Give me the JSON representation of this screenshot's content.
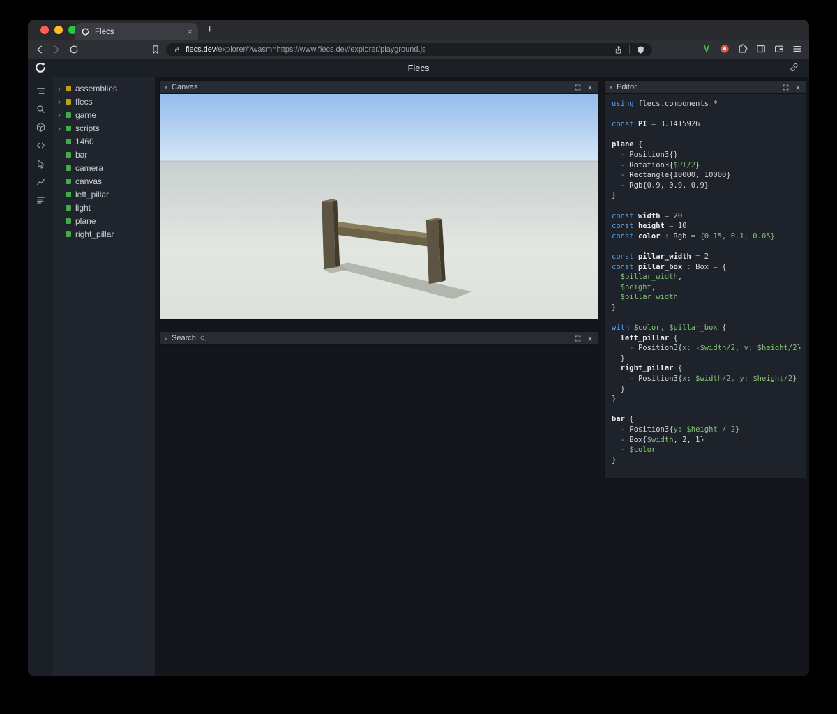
{
  "browser": {
    "tab": {
      "title": "Flecs"
    },
    "new_tab_label": "+",
    "url": {
      "domain": "flecs.dev",
      "path": "/explorer/?wasm=https://www.flecs.dev/explorer/playground.js"
    },
    "toolbar_icon_names": [
      "back-icon",
      "forward-icon",
      "reload-icon",
      "bookmark-icon",
      "lock-icon",
      "share-icon",
      "brave-shield-icon",
      "vimium-extension-icon",
      "red-extension-icon",
      "extensions-puzzle-icon",
      "sidebar-toggle-icon",
      "wallet-icon",
      "menu-icon"
    ]
  },
  "app": {
    "header": {
      "title": "Flecs"
    },
    "sidebar_tools": [
      {
        "name": "entity-tree",
        "icon": "tree"
      },
      {
        "name": "query-search",
        "icon": "search"
      },
      {
        "name": "entities-cube",
        "icon": "cube"
      },
      {
        "name": "script-code",
        "icon": "code"
      },
      {
        "name": "inspector",
        "icon": "inspect"
      },
      {
        "name": "charts",
        "icon": "chart"
      },
      {
        "name": "stats",
        "icon": "stats"
      }
    ],
    "tree": {
      "items": [
        {
          "label": "assemblies",
          "expandable": true,
          "color": "#bfa118"
        },
        {
          "label": "flecs",
          "expandable": true,
          "color": "#bfa118"
        },
        {
          "label": "game",
          "expandable": true,
          "color": "#3fae49"
        },
        {
          "label": "scripts",
          "expandable": true,
          "color": "#3fae49"
        },
        {
          "label": "1460",
          "expandable": false,
          "color": "#3fae49"
        },
        {
          "label": "bar",
          "expandable": false,
          "color": "#3fae49"
        },
        {
          "label": "camera",
          "expandable": false,
          "color": "#3fae49"
        },
        {
          "label": "canvas",
          "expandable": false,
          "color": "#3fae49"
        },
        {
          "label": "left_pillar",
          "expandable": false,
          "color": "#3fae49"
        },
        {
          "label": "light",
          "expandable": false,
          "color": "#3fae49"
        },
        {
          "label": "plane",
          "expandable": false,
          "color": "#3fae49"
        },
        {
          "label": "right_pillar",
          "expandable": false,
          "color": "#3fae49"
        }
      ]
    },
    "panels": {
      "canvas": {
        "title": "Canvas"
      },
      "search": {
        "title": "Search"
      },
      "editor": {
        "title": "Editor"
      }
    },
    "scene": {
      "objects": [
        "plane",
        "left_pillar",
        "right_pillar",
        "bar"
      ],
      "sky_top": "#93bdeb",
      "sky_bottom": "#d5e5f7",
      "ground": "#dfe3de",
      "pillar_color": "#5d5443",
      "bar_color": "#6b6147"
    },
    "editor_code": {
      "lines": [
        [
          [
            "k",
            "using "
          ],
          [
            "w",
            "flecs"
          ],
          [
            "p",
            "."
          ],
          [
            "w",
            "components"
          ],
          [
            "p",
            "."
          ],
          [
            "w",
            "*"
          ]
        ],
        [],
        [
          [
            "k",
            "const "
          ],
          [
            "b",
            "PI"
          ],
          [
            "p",
            " = "
          ],
          [
            "w",
            "3.1415926"
          ]
        ],
        [],
        [
          [
            "b",
            "plane"
          ],
          [
            "w",
            " {"
          ]
        ],
        [
          [
            "p",
            "  - "
          ],
          [
            "w",
            "Position3{}"
          ]
        ],
        [
          [
            "p",
            "  - "
          ],
          [
            "w",
            "Rotation3{"
          ],
          [
            "g",
            "$PI/2"
          ],
          [
            "w",
            "}"
          ]
        ],
        [
          [
            "p",
            "  - "
          ],
          [
            "w",
            "Rectangle{10000, 10000}"
          ]
        ],
        [
          [
            "p",
            "  - "
          ],
          [
            "w",
            "Rgb{0.9, 0.9, 0.9}"
          ]
        ],
        [
          [
            "w",
            "}"
          ]
        ],
        [],
        [
          [
            "k",
            "const "
          ],
          [
            "b",
            "width"
          ],
          [
            "p",
            " = "
          ],
          [
            "w",
            "20"
          ]
        ],
        [
          [
            "k",
            "const "
          ],
          [
            "b",
            "height"
          ],
          [
            "p",
            " = "
          ],
          [
            "w",
            "10"
          ]
        ],
        [
          [
            "k",
            "const "
          ],
          [
            "b",
            "color"
          ],
          [
            "p",
            " : "
          ],
          [
            "w",
            "Rgb"
          ],
          [
            "p",
            " = "
          ],
          [
            "g",
            "{0.15, 0.1, 0.05}"
          ]
        ],
        [],
        [
          [
            "k",
            "const "
          ],
          [
            "b",
            "pillar_width"
          ],
          [
            "p",
            " = "
          ],
          [
            "w",
            "2"
          ]
        ],
        [
          [
            "k",
            "const "
          ],
          [
            "b",
            "pillar_box"
          ],
          [
            "p",
            " : "
          ],
          [
            "w",
            "Box"
          ],
          [
            "p",
            " = "
          ],
          [
            "w",
            "{"
          ]
        ],
        [
          [
            "g",
            "  $pillar_width"
          ],
          [
            "w",
            ","
          ]
        ],
        [
          [
            "g",
            "  $height"
          ],
          [
            "w",
            ","
          ]
        ],
        [
          [
            "g",
            "  $pillar_width"
          ]
        ],
        [
          [
            "w",
            "}"
          ]
        ],
        [],
        [
          [
            "k",
            "with "
          ],
          [
            "g",
            "$color"
          ],
          [
            "p",
            ", "
          ],
          [
            "g",
            "$pillar_box"
          ],
          [
            "w",
            " {"
          ]
        ],
        [
          [
            "b",
            "  left_pillar"
          ],
          [
            "w",
            " {"
          ]
        ],
        [
          [
            "p",
            "    - "
          ],
          [
            "w",
            "Position3{"
          ],
          [
            "g",
            "x: -$width/2"
          ],
          [
            "p",
            ", "
          ],
          [
            "g",
            "y: $height/2"
          ],
          [
            "w",
            "}"
          ]
        ],
        [
          [
            "w",
            "  }"
          ]
        ],
        [
          [
            "b",
            "  right_pillar"
          ],
          [
            "w",
            " {"
          ]
        ],
        [
          [
            "p",
            "    - "
          ],
          [
            "w",
            "Position3{"
          ],
          [
            "g",
            "x: $width/2"
          ],
          [
            "p",
            ", "
          ],
          [
            "g",
            "y: $height/2"
          ],
          [
            "w",
            "}"
          ]
        ],
        [
          [
            "w",
            "  }"
          ]
        ],
        [
          [
            "w",
            "}"
          ]
        ],
        [],
        [
          [
            "b",
            "bar"
          ],
          [
            "w",
            " {"
          ]
        ],
        [
          [
            "p",
            "  - "
          ],
          [
            "w",
            "Position3{"
          ],
          [
            "g",
            "y: $height / 2"
          ],
          [
            "w",
            "}"
          ]
        ],
        [
          [
            "p",
            "  - "
          ],
          [
            "w",
            "Box{"
          ],
          [
            "g",
            "$width"
          ],
          [
            "w",
            ", 2, 1}"
          ]
        ],
        [
          [
            "p",
            "  - "
          ],
          [
            "g",
            "$color"
          ]
        ],
        [
          [
            "w",
            "}"
          ]
        ]
      ]
    }
  },
  "colors": {
    "traffic_red": "#ff5f57",
    "traffic_yellow": "#febc2e",
    "traffic_green": "#28c840",
    "module_square": "#bfa118",
    "entity_square": "#3fae49",
    "code_keyword": "#5ca1e6",
    "code_variable": "#83c177",
    "code_default": "#d2d6db"
  }
}
